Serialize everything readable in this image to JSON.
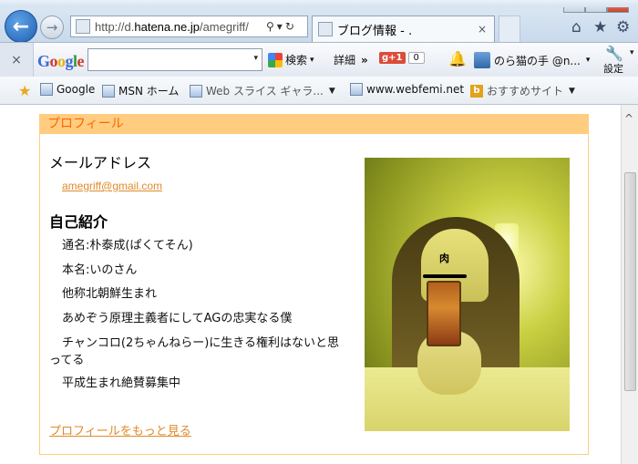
{
  "browser": {
    "address": {
      "prefix": "http://d.",
      "host": "hatena.ne.jp",
      "path": "/amegriff/",
      "search_glyph": "⚲",
      "dropdown_glyph": "▾",
      "refresh_glyph": "↻"
    },
    "back_glyph": "←",
    "forward_glyph": "→",
    "tab": {
      "title": "ブログ情報 - .",
      "close_glyph": "×"
    },
    "window_controls": {
      "minimize": "—",
      "maximize": "▢",
      "close": "✕"
    },
    "tool_icons": {
      "home": "⌂",
      "favorites": "★",
      "tools": "⚙"
    }
  },
  "google_toolbar": {
    "close_glyph": "×",
    "logo": [
      "G",
      "o",
      "o",
      "g",
      "l",
      "e"
    ],
    "logo_colors": [
      "#3b6ad8",
      "#d23b2a",
      "#e9b000",
      "#3b6ad8",
      "#2f9a3a",
      "#d23b2a"
    ],
    "search_value": "",
    "search_dropdown": "▾",
    "search_button": "検索",
    "details_button": "詳細",
    "more_glyph": "»",
    "gplus_label": "g+1",
    "gplus_count": "0",
    "bell_icon": "🔔",
    "user_label": "のら猫の手 @n...",
    "user_dropdown": "▾",
    "settings_label": "設定",
    "settings_glyph": "🔧",
    "settings_dropdown": "▾"
  },
  "favorites": {
    "star_glyph": "★",
    "items": [
      {
        "label": "Google"
      },
      {
        "label": "MSN ホーム"
      },
      {
        "label": "Web スライス ギャラ..."
      },
      {
        "label": "www.webfemi.net"
      },
      {
        "label": "おすすめサイト"
      }
    ],
    "dropdown_glyph": "▼",
    "bing_letter": "b"
  },
  "page": {
    "section_title": "プロフィール",
    "mail_heading": "メールアドレス",
    "mail_address": "amegriff@gmail.com",
    "intro_heading": "自己紹介",
    "intro_lines": [
      "通名:朴泰成(ぱくてそん)",
      "本名:いのさん",
      "他称北朝鮮生まれ",
      "あめぞう原理主義者にしてAGの忠実なる僕",
      "チャンコロ(2ちゃんねらー)に生きる権利はないと思ってる",
      "平成生まれ絶賛募集中"
    ],
    "photo_overlay_text": "肉",
    "more_link": "プロフィールをもっと見る"
  },
  "scrollbar": {
    "up_glyph": "^"
  }
}
